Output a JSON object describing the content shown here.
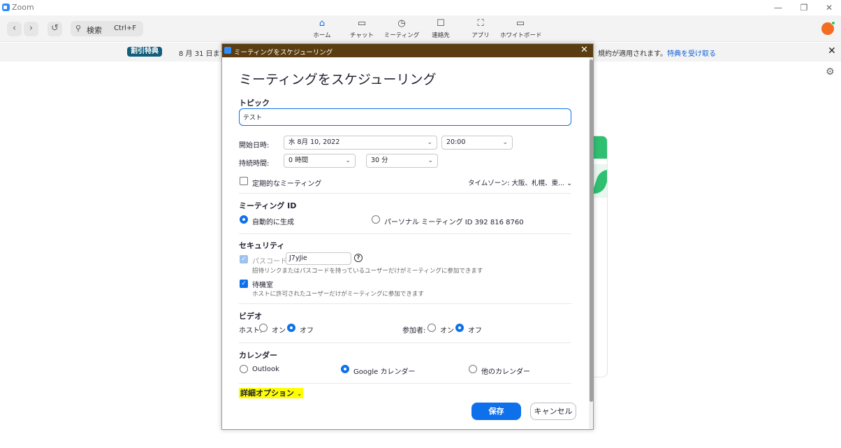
{
  "window": {
    "app_title": "Zoom"
  },
  "nav": {
    "search_label": "検索",
    "search_shortcut": "Ctrl+F",
    "tabs": [
      {
        "label": "ホーム",
        "icon": "home-icon"
      },
      {
        "label": "チャット",
        "icon": "chat-icon"
      },
      {
        "label": "ミーティング",
        "icon": "clock-icon"
      },
      {
        "label": "連絡先",
        "icon": "contacts-icon"
      },
      {
        "label": "アプリ",
        "icon": "apps-icon"
      },
      {
        "label": "ホワイトボード",
        "icon": "whiteboard-icon"
      }
    ],
    "active_tab": "ホーム"
  },
  "banner": {
    "badge": "割引特典",
    "text_left": "8 月 31 日まで",
    "text_right": "規約が適用されます。",
    "link": "特典を受け取る"
  },
  "dialog": {
    "window_title": "ミーティングをスケジューリング",
    "heading": "ミーティングをスケジューリング",
    "topic": {
      "label": "トピック",
      "value": "テスト"
    },
    "start": {
      "label": "開始日時:",
      "date": "水 8月 10, 2022",
      "time": "20:00"
    },
    "duration": {
      "label": "持続時間:",
      "hours": "0 時間",
      "minutes": "30 分"
    },
    "recurring": {
      "label": "定期的なミーティング",
      "checked": false
    },
    "timezone": "タイムゾーン: 大阪、札幌、東...",
    "meeting_id": {
      "label": "ミーティング ID",
      "auto": "自動的に生成",
      "personal": "パーソナル ミーティング ID 392 816 8760",
      "selected": "auto"
    },
    "security": {
      "label": "セキュリティ",
      "passcode_label": "パスコード",
      "passcode_value": "J7yJie",
      "passcode_hint": "招待リンクまたはパスコードを持っているユーザーだけがミーティングに参加できます",
      "waiting_room_label": "待機室",
      "waiting_room_hint": "ホストに許可されたユーザーだけがミーティングに参加できます"
    },
    "video": {
      "label": "ビデオ",
      "host_label": "ホスト:",
      "participant_label": "参加者:",
      "on": "オン",
      "off": "オフ",
      "host_selected": "off",
      "participant_selected": "off"
    },
    "calendar": {
      "label": "カレンダー",
      "options": [
        "Outlook",
        "Google カレンダー",
        "他のカレンダー"
      ],
      "selected": "Google カレンダー"
    },
    "advanced_label": "詳細オプション",
    "save_label": "保存",
    "cancel_label": "キャンセル"
  },
  "colors": {
    "accent": "#0e71eb",
    "dialog_titlebar": "#5a3d10",
    "avatar": "#f26d21",
    "highlight": "#ffff00"
  }
}
